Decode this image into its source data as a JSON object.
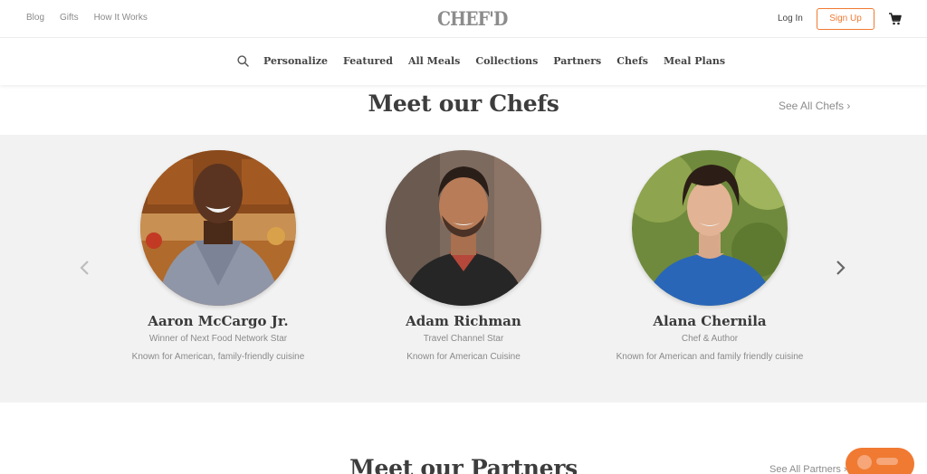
{
  "topbar": {
    "left_links": [
      "Blog",
      "Gifts",
      "How It Works"
    ],
    "logo": "CHEF'D",
    "login": "Log In",
    "signup": "Sign Up",
    "cart_icon": "cart-icon"
  },
  "nav": {
    "search_icon": "search-icon",
    "items": [
      "Personalize",
      "Featured",
      "All Meals",
      "Collections",
      "Partners",
      "Chefs",
      "Meal Plans"
    ]
  },
  "chefs_section": {
    "title": "Meet our Chefs",
    "see_all": "See All Chefs ›",
    "prev_icon": "chevron-left-icon",
    "next_icon": "chevron-right-icon",
    "chefs": [
      {
        "name": "Aaron McCargo Jr.",
        "subtitle": "Winner of Next Food Network Star",
        "known": "Known for American, family-friendly cuisine"
      },
      {
        "name": "Adam Richman",
        "subtitle": "Travel Channel Star",
        "known": "Known for American Cuisine"
      },
      {
        "name": "Alana Chernila",
        "subtitle": "Chef & Author",
        "known": "Known for American and family friendly cuisine"
      }
    ]
  },
  "partners_section": {
    "title": "Meet our Partners",
    "see_all": "See All Partners ›"
  },
  "colors": {
    "accent": "#f07a32",
    "band": "#f2f2f2",
    "heading": "#3d3d3d"
  }
}
